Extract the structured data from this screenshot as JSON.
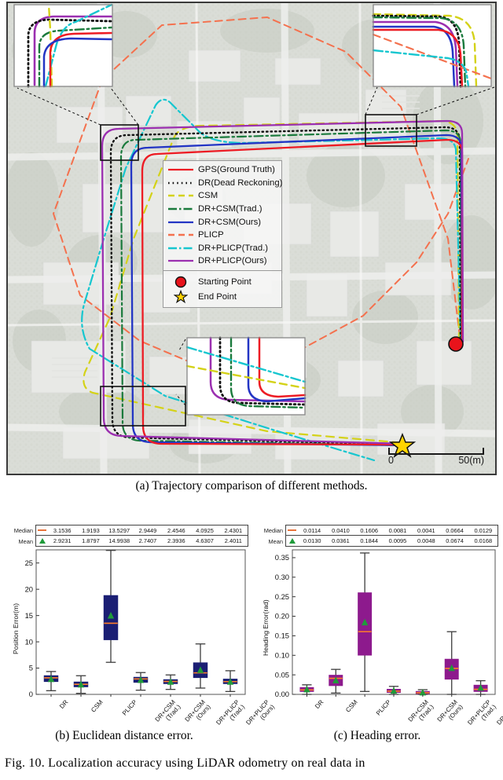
{
  "figure": {
    "caption_a": "(a) Trajectory comparison of different methods.",
    "caption_b": "(b) Euclidean distance error.",
    "caption_c": "(c) Heading error.",
    "fig_caption": "Fig. 10.   Localization accuracy using LiDAR odometry on real data in"
  },
  "map": {
    "legend": {
      "items": [
        {
          "label": "GPS(Ground Truth)",
          "color": "#ed1c24",
          "style": "solid",
          "key": "line-solid-red"
        },
        {
          "label": "DR(Dead Reckoning)",
          "color": "#000000",
          "style": "dotted",
          "key": "line-dotted-black"
        },
        {
          "label": "CSM",
          "color": "#d4d218",
          "style": "dashed",
          "key": "line-dashed-yellow"
        },
        {
          "label": "DR+CSM(Trad.)",
          "color": "#1a7a3c",
          "style": "dashdot",
          "key": "line-dashdot-green"
        },
        {
          "label": "DR+CSM(Ours)",
          "color": "#2335c4",
          "style": "solid",
          "key": "line-solid-blue"
        },
        {
          "label": "PLICP",
          "color": "#f4714e",
          "style": "dashed",
          "key": "line-dashed-salmon"
        },
        {
          "label": "DR+PLICP(Trad.)",
          "color": "#16c6cf",
          "style": "dashdot",
          "key": "line-dashdot-cyan"
        },
        {
          "label": "DR+PLICP(Ours)",
          "color": "#9b2fb0",
          "style": "solid",
          "key": "line-solid-purple"
        }
      ],
      "markers": [
        {
          "label": "Starting Point",
          "shape": "circle",
          "fill": "#e8131b",
          "stroke": "#111111"
        },
        {
          "label": "End Point",
          "shape": "star",
          "fill": "#ffd400",
          "stroke": "#111111"
        }
      ]
    },
    "scalebar": {
      "left_label": "0",
      "right_label": "50(m)"
    }
  },
  "chart_data": [
    {
      "type": "box",
      "panel": "b",
      "title": "(b) Euclidean distance error.",
      "ylabel": "Position Error(m)",
      "xlabel": "",
      "ylim": [
        0,
        27.5
      ],
      "yticks": [
        0,
        5,
        10,
        15,
        20,
        25
      ],
      "grid": false,
      "box_fill": "#1b1f74",
      "median_color": "#ff7f2a",
      "mean_color": "#1f9b3a",
      "whisker_color": "#3d3d3d",
      "categories": [
        "DR",
        "CSM",
        "PLICP",
        "DR+CSM\n(Trad.)",
        "DR+CSM\n(Ours)",
        "DR+PLICP\n(Trad.)",
        "DR+PLICP\n(Ours)"
      ],
      "category_lines": [
        [
          "DR"
        ],
        [
          "CSM"
        ],
        [
          "PLICP"
        ],
        [
          "DR+CSM",
          "(Trad.)"
        ],
        [
          "DR+CSM",
          "(Ours)"
        ],
        [
          "DR+PLICP",
          "(Trad.)"
        ],
        [
          "DR+PLICP",
          "(Ours)"
        ]
      ],
      "stats_table": {
        "rows": [
          {
            "name": "Median",
            "marker": "line",
            "values": [
              "3.1536",
              "1.9193",
              "13.5297",
              "2.9449",
              "2.4546",
              "4.0925",
              "2.4301"
            ]
          },
          {
            "name": "Mean",
            "marker": "triangle",
            "values": [
              "2.9231",
              "1.8797",
              "14.9938",
              "2.7407",
              "2.3936",
              "4.6307",
              "2.4011"
            ]
          }
        ]
      },
      "boxes": [
        {
          "category": "DR",
          "whisker_low": 0.7,
          "q1": 2.45,
          "median": 3.1536,
          "q3": 3.55,
          "whisker_high": 4.35,
          "mean": 2.9231
        },
        {
          "category": "CSM",
          "whisker_low": 0.2,
          "q1": 1.45,
          "median": 1.9193,
          "q3": 2.35,
          "whisker_high": 3.55,
          "mean": 1.8797
        },
        {
          "category": "PLICP",
          "whisker_low": 6.1,
          "q1": 10.4,
          "median": 13.5297,
          "q3": 18.8,
          "whisker_high": 27.4,
          "mean": 14.9938
        },
        {
          "category": "DR+CSM(Trad.)",
          "whisker_low": 0.8,
          "q1": 2.3,
          "median": 2.9449,
          "q3": 3.25,
          "whisker_high": 4.15,
          "mean": 2.7407
        },
        {
          "category": "DR+CSM(Ours)",
          "whisker_low": 0.95,
          "q1": 2.05,
          "median": 2.4546,
          "q3": 2.8,
          "whisker_high": 3.7,
          "mean": 2.3936
        },
        {
          "category": "DR+PLICP(Trad.)",
          "whisker_low": 1.2,
          "q1": 3.2,
          "median": 4.0925,
          "q3": 6.0,
          "whisker_high": 9.6,
          "mean": 4.6307
        },
        {
          "category": "DR+PLICP(Ours)",
          "whisker_low": 0.55,
          "q1": 2.05,
          "median": 2.4301,
          "q3": 2.9,
          "whisker_high": 4.5,
          "mean": 2.4011
        }
      ]
    },
    {
      "type": "box",
      "panel": "c",
      "title": "(c) Heading error.",
      "ylabel": "Heading Error(rad)",
      "xlabel": "",
      "ylim": [
        0,
        0.37
      ],
      "yticks": [
        0.0,
        0.05,
        0.1,
        0.15,
        0.2,
        0.25,
        0.3,
        0.35
      ],
      "ytick_labels": [
        "0.00",
        "0.05",
        "0.10",
        "0.15",
        "0.20",
        "0.25",
        "0.30",
        "0.35"
      ],
      "grid": false,
      "box_fill": "#8d1a8d",
      "median_color": "#ff7f2a",
      "mean_color": "#1f9b3a",
      "whisker_color": "#3d3d3d",
      "categories": [
        "DR",
        "CSM",
        "PLICP",
        "DR+CSM\n(Trad.)",
        "DR+CSM\n(Ours)",
        "DR+PLICP\n(Trad.)",
        "DR+PLICP\n(Ours)"
      ],
      "category_lines": [
        [
          "DR"
        ],
        [
          "CSM"
        ],
        [
          "PLICP"
        ],
        [
          "DR+CSM",
          "(Trad.)"
        ],
        [
          "DR+CSM",
          "(Ours)"
        ],
        [
          "DR+PLICP",
          "(Trad.)"
        ],
        [
          "DR+PLICP",
          "(Ours)"
        ]
      ],
      "stats_table": {
        "rows": [
          {
            "name": "Median",
            "marker": "line",
            "values": [
              "0.0114",
              "0.0410",
              "0.1606",
              "0.0081",
              "0.0041",
              "0.0664",
              "0.0129"
            ]
          },
          {
            "name": "Mean",
            "marker": "triangle",
            "values": [
              "0.0130",
              "0.0361",
              "0.1844",
              "0.0095",
              "0.0048",
              "0.0674",
              "0.0168"
            ]
          }
        ]
      },
      "boxes": [
        {
          "category": "DR",
          "whisker_low": 0.0,
          "q1": 0.0075,
          "median": 0.0114,
          "q3": 0.0175,
          "whisker_high": 0.0245,
          "mean": 0.013
        },
        {
          "category": "CSM",
          "whisker_low": 0.0035,
          "q1": 0.0225,
          "median": 0.041,
          "q3": 0.049,
          "whisker_high": 0.064,
          "mean": 0.0361
        },
        {
          "category": "PLICP",
          "whisker_low": 0.0075,
          "q1": 0.1005,
          "median": 0.1606,
          "q3": 0.26,
          "whisker_high": 0.362,
          "mean": 0.1844
        },
        {
          "category": "DR+CSM(Trad.)",
          "whisker_low": 0.0,
          "q1": 0.005,
          "median": 0.0081,
          "q3": 0.013,
          "whisker_high": 0.0205,
          "mean": 0.0095
        },
        {
          "category": "DR+CSM(Ours)",
          "whisker_low": 0.0,
          "q1": 0.002,
          "median": 0.0041,
          "q3": 0.0075,
          "whisker_high": 0.012,
          "mean": 0.0048
        },
        {
          "category": "DR+PLICP(Trad.)",
          "whisker_low": 0.0,
          "q1": 0.039,
          "median": 0.0664,
          "q3": 0.09,
          "whisker_high": 0.1605,
          "mean": 0.0674
        },
        {
          "category": "DR+PLICP(Ours)",
          "whisker_low": 0.0,
          "q1": 0.0075,
          "median": 0.0129,
          "q3": 0.0235,
          "whisker_high": 0.035,
          "mean": 0.0168
        }
      ]
    }
  ]
}
